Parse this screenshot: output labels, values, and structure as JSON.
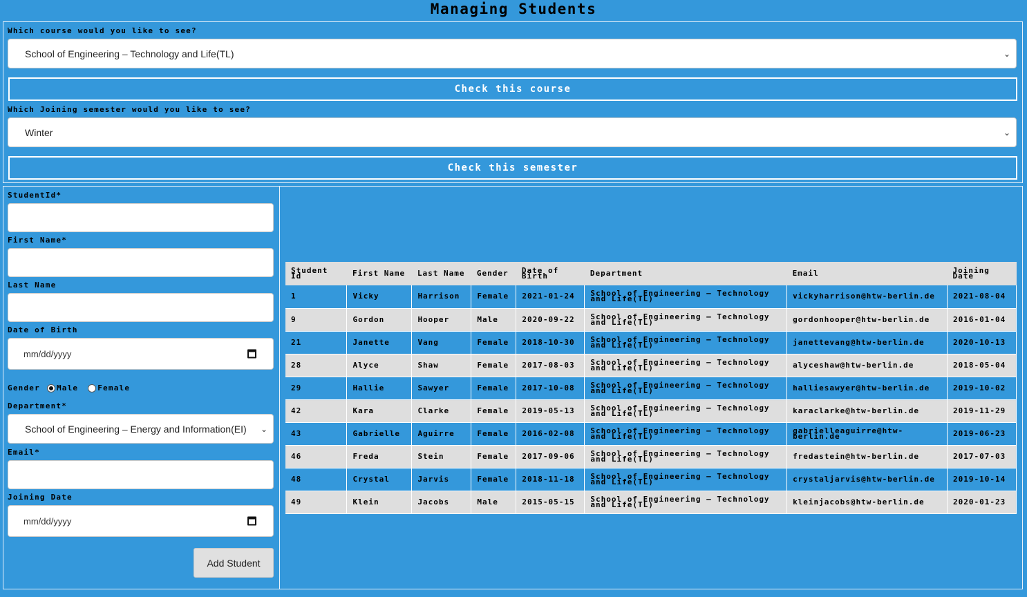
{
  "header": {
    "title": "Managing Students"
  },
  "course_filter": {
    "label": "Which course would you like to see?",
    "selected": "School of Engineering – Technology and Life(TL)",
    "button_label": "Check this course"
  },
  "semester_filter": {
    "label": "Which Joining semester would you like to see?",
    "selected": "Winter",
    "button_label": "Check this semester"
  },
  "form": {
    "student_id_label": "StudentId*",
    "first_name_label": "First Name*",
    "last_name_label": "Last Name",
    "dob_label": "Date of Birth",
    "dob_placeholder": "mm/dd/yyyy",
    "gender_label": "Gender",
    "gender_male": "Male",
    "gender_female": "Female",
    "gender_selected": "Male",
    "department_label": "Department*",
    "department_selected": "School of Engineering – Energy and Information(EI)",
    "email_label": "Email*",
    "joining_date_label": "Joining Date",
    "joining_date_placeholder": "mm/dd/yyyy",
    "add_button_label": "Add Student"
  },
  "table": {
    "headers": [
      "Student Id",
      "First Name",
      "Last Name",
      "Gender",
      "Date of Birth",
      "Department",
      "Email",
      "Joining Date"
    ],
    "rows": [
      [
        "1",
        "Vicky",
        "Harrison",
        "Female",
        "2021-01-24",
        "School of Engineering – Technology and Life(TL)",
        "vickyharrison@htw-berlin.de",
        "2021-08-04"
      ],
      [
        "9",
        "Gordon",
        "Hooper",
        "Male",
        "2020-09-22",
        "School of Engineering – Technology and Life(TL)",
        "gordonhooper@htw-berlin.de",
        "2016-01-04"
      ],
      [
        "21",
        "Janette",
        "Vang",
        "Female",
        "2018-10-30",
        "School of Engineering – Technology and Life(TL)",
        "janettevang@htw-berlin.de",
        "2020-10-13"
      ],
      [
        "28",
        "Alyce",
        "Shaw",
        "Female",
        "2017-08-03",
        "School of Engineering – Technology and Life(TL)",
        "alyceshaw@htw-berlin.de",
        "2018-05-04"
      ],
      [
        "29",
        "Hallie",
        "Sawyer",
        "Female",
        "2017-10-08",
        "School of Engineering – Technology and Life(TL)",
        "halliesawyer@htw-berlin.de",
        "2019-10-02"
      ],
      [
        "42",
        "Kara",
        "Clarke",
        "Female",
        "2019-05-13",
        "School of Engineering – Technology and Life(TL)",
        "karaclarke@htw-berlin.de",
        "2019-11-29"
      ],
      [
        "43",
        "Gabrielle",
        "Aguirre",
        "Female",
        "2016-02-08",
        "School of Engineering – Technology and Life(TL)",
        "gabrielleaguirre@htw-berlin.de",
        "2019-06-23"
      ],
      [
        "46",
        "Freda",
        "Stein",
        "Female",
        "2017-09-06",
        "School of Engineering – Technology and Life(TL)",
        "fredastein@htw-berlin.de",
        "2017-07-03"
      ],
      [
        "48",
        "Crystal",
        "Jarvis",
        "Female",
        "2018-11-18",
        "School of Engineering – Technology and Life(TL)",
        "crystaljarvis@htw-berlin.de",
        "2019-10-14"
      ],
      [
        "49",
        "Klein",
        "Jacobs",
        "Male",
        "2015-05-15",
        "School of Engineering – Technology and Life(TL)",
        "kleinjacobs@htw-berlin.de",
        "2020-01-23"
      ]
    ]
  },
  "colors": {
    "background": "#3498db",
    "row_alt": "#dedede",
    "border": "#ffffff"
  }
}
